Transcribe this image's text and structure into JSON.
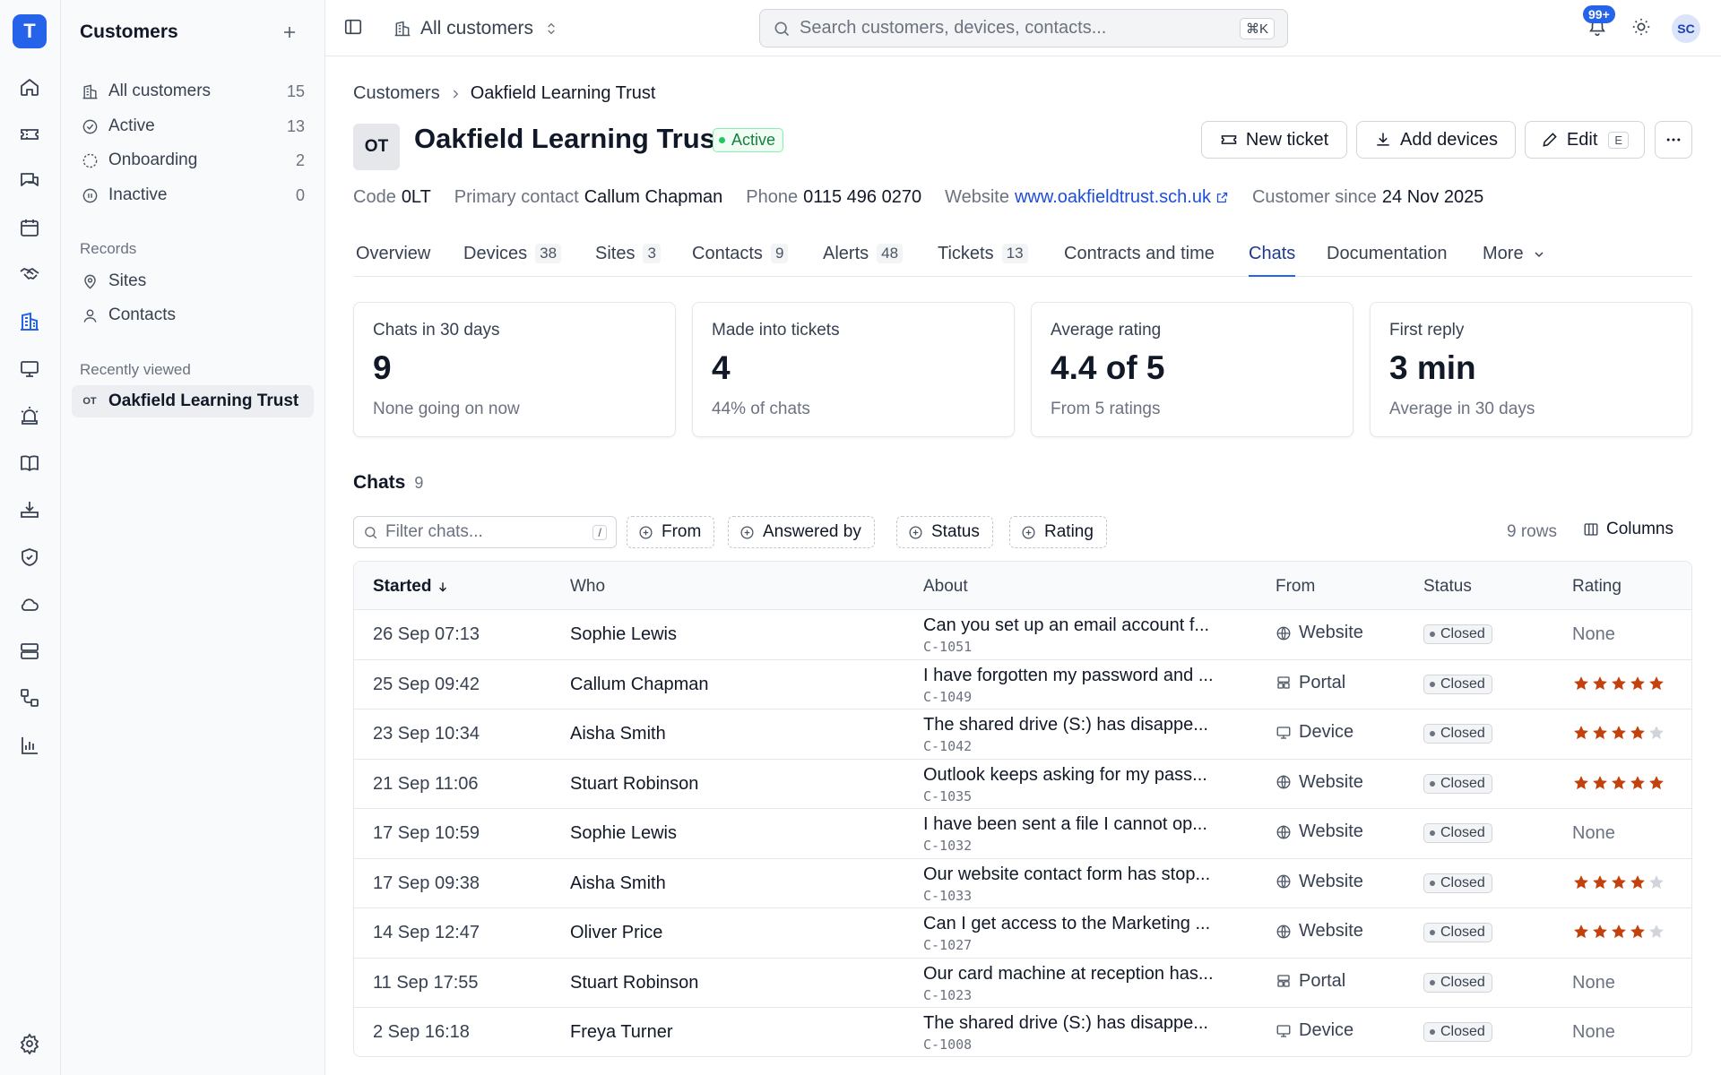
{
  "brand": {
    "logo_letter": "T",
    "accent": "#2563eb"
  },
  "rail": {
    "icons": [
      "home-icon",
      "ticket-icon",
      "chat-icon",
      "calendar-icon",
      "handshake-icon",
      "building-icon",
      "monitor-icon",
      "alarm-icon",
      "book-icon",
      "download-tray-icon",
      "shield-icon",
      "cloud-icon",
      "server-icon",
      "workflow-icon",
      "bar-chart-icon"
    ],
    "active": "building-icon",
    "bottom_icon": "gear-icon"
  },
  "sidebar": {
    "title": "Customers",
    "items": [
      {
        "label": "All customers",
        "count": "15",
        "icon": "building-icon",
        "selected": false
      },
      {
        "label": "Active",
        "count": "13",
        "icon": "check-circle-icon",
        "selected": false
      },
      {
        "label": "Onboarding",
        "count": "2",
        "icon": "dashed-circle-icon",
        "selected": false
      },
      {
        "label": "Inactive",
        "count": "0",
        "icon": "pause-circle-icon",
        "selected": false
      }
    ],
    "records_label": "Records",
    "records": [
      {
        "label": "Sites",
        "icon": "map-pin-icon"
      },
      {
        "label": "Contacts",
        "icon": "person-icon"
      }
    ],
    "recent_label": "Recently viewed",
    "recent": [
      {
        "abbr": "OT",
        "label": "Oakfield Learning Trust"
      }
    ]
  },
  "topbar": {
    "scope": "All customers",
    "search_placeholder": "Search customers, devices, contacts...",
    "search_shortcut": "⌘K",
    "notification_badge": "99+",
    "avatar_initials": "SC"
  },
  "breadcrumb": {
    "root": "Customers",
    "current": "Oakfield Learning Trust"
  },
  "customer": {
    "initials": "OT",
    "name": "Oakfield Learning Trust",
    "status": "Active",
    "status_color": "#15803d"
  },
  "actions": {
    "new_ticket": "New ticket",
    "add_devices": "Add devices",
    "edit": "Edit",
    "edit_shortcut": "E"
  },
  "meta": {
    "code_label": "Code",
    "code": "0LT",
    "contact_label": "Primary contact",
    "contact": "Callum Chapman",
    "phone_label": "Phone",
    "phone": "0115 496 0270",
    "website_label": "Website",
    "website": "www.oakfieldtrust.sch.uk",
    "since_label": "Customer since",
    "since": "24 Nov 2025"
  },
  "tabs": [
    {
      "label": "Overview",
      "count": ""
    },
    {
      "label": "Devices",
      "count": "38"
    },
    {
      "label": "Sites",
      "count": "3"
    },
    {
      "label": "Contacts",
      "count": "9"
    },
    {
      "label": "Alerts",
      "count": "48"
    },
    {
      "label": "Tickets",
      "count": "13"
    },
    {
      "label": "Contracts and time",
      "count": ""
    },
    {
      "label": "Chats",
      "count": "",
      "active": true
    },
    {
      "label": "Documentation",
      "count": ""
    },
    {
      "label": "More",
      "count": ""
    }
  ],
  "stats": [
    {
      "label": "Chats in 30 days",
      "value": "9",
      "sub": "None going on now"
    },
    {
      "label": "Made into tickets",
      "value": "4",
      "sub": "44% of chats"
    },
    {
      "label": "Average rating",
      "value": "4.4 of 5",
      "sub": "From 5 ratings"
    },
    {
      "label": "First reply",
      "value": "3 min",
      "sub": "Average in 30 days"
    }
  ],
  "chats": {
    "title": "Chats",
    "count": "9",
    "filter_placeholder": "Filter chats...",
    "filter_shortcut": "/",
    "filter_chips": [
      "From",
      "Answered by",
      "Status",
      "Rating"
    ],
    "row_count": "9 rows",
    "columns_label": "Columns",
    "headers": [
      "Started",
      "Who",
      "About",
      "From",
      "Status",
      "Rating"
    ],
    "star_color": "#c2410c",
    "rows": [
      {
        "started": "26 Sep 07:13",
        "who": "Sophie Lewis",
        "about": "Can you set up an email account f...",
        "ref": "C-1051",
        "from": "Website",
        "from_icon": "globe-icon",
        "status": "Closed",
        "rating": null,
        "rating_text": "None"
      },
      {
        "started": "25 Sep 09:42",
        "who": "Callum Chapman",
        "about": "I have forgotten my password and ...",
        "ref": "C-1049",
        "from": "Portal",
        "from_icon": "portal-icon",
        "status": "Closed",
        "rating": 5,
        "rating_text": ""
      },
      {
        "started": "23 Sep 10:34",
        "who": "Aisha Smith",
        "about": "The shared drive (S:) has disappe...",
        "ref": "C-1042",
        "from": "Device",
        "from_icon": "monitor-icon",
        "status": "Closed",
        "rating": 4,
        "rating_text": ""
      },
      {
        "started": "21 Sep 11:06",
        "who": "Stuart Robinson",
        "about": "Outlook keeps asking for my pass...",
        "ref": "C-1035",
        "from": "Website",
        "from_icon": "globe-icon",
        "status": "Closed",
        "rating": 5,
        "rating_text": ""
      },
      {
        "started": "17 Sep 10:59",
        "who": "Sophie Lewis",
        "about": "I have been sent a file I cannot op...",
        "ref": "C-1032",
        "from": "Website",
        "from_icon": "globe-icon",
        "status": "Closed",
        "rating": null,
        "rating_text": "None"
      },
      {
        "started": "17 Sep 09:38",
        "who": "Aisha Smith",
        "about": "Our website contact form has stop...",
        "ref": "C-1033",
        "from": "Website",
        "from_icon": "globe-icon",
        "status": "Closed",
        "rating": 4,
        "rating_text": ""
      },
      {
        "started": "14 Sep 12:47",
        "who": "Oliver Price",
        "about": "Can I get access to the Marketing ...",
        "ref": "C-1027",
        "from": "Website",
        "from_icon": "globe-icon",
        "status": "Closed",
        "rating": 4,
        "rating_text": ""
      },
      {
        "started": "11 Sep 17:55",
        "who": "Stuart Robinson",
        "about": "Our card machine at reception has...",
        "ref": "C-1023",
        "from": "Portal",
        "from_icon": "portal-icon",
        "status": "Closed",
        "rating": null,
        "rating_text": "None"
      },
      {
        "started": "2 Sep 16:18",
        "who": "Freya Turner",
        "about": "The shared drive (S:) has disappe...",
        "ref": "C-1008",
        "from": "Device",
        "from_icon": "monitor-icon",
        "status": "Closed",
        "rating": null,
        "rating_text": "None"
      }
    ]
  }
}
